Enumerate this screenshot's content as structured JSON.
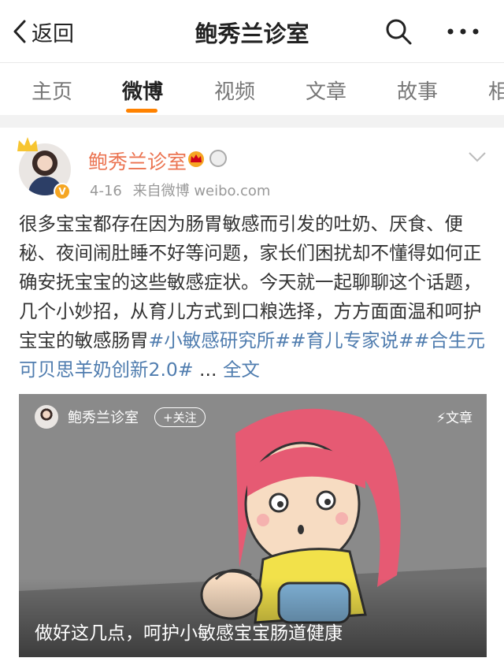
{
  "topbar": {
    "back_label": "返回",
    "title": "鲍秀兰诊室",
    "search_icon": "search-icon",
    "more_icon": "more-icon"
  },
  "tabs": [
    {
      "label": "主页"
    },
    {
      "label": "微博"
    },
    {
      "label": "视频"
    },
    {
      "label": "文章"
    },
    {
      "label": "故事"
    },
    {
      "label": "相"
    }
  ],
  "tabs_active": "微博",
  "post": {
    "author": "鲍秀兰诊室",
    "date": "4-16",
    "source": "来自微博 weibo.com",
    "text_before": "很多宝宝都存在因为肠胃敏感而引发的吐奶、厌食、便秘、夜间闹肚睡不好等问题，家长们困扰却不懂得如何正确安抚宝宝的这些敏感症状。今天就一起聊聊这个话题，几个小妙招，从育儿方式到口粮选择，方方面面温和呵护宝宝的敏感肠胃",
    "tags": [
      "#小敏感研究所#",
      "#育儿专家说#",
      "#合生元可贝思羊奶创新2.0#"
    ],
    "ellipsis": " ... ",
    "full_text": "全文",
    "card": {
      "name": "鲍秀兰诊室",
      "follow": "+关注",
      "type": "文章",
      "caption": "做好这几点，呵护小敏感宝宝肠道健康"
    }
  },
  "colors": {
    "accent": "#ff8200",
    "link": "#507daf",
    "author": "#eb7350"
  }
}
